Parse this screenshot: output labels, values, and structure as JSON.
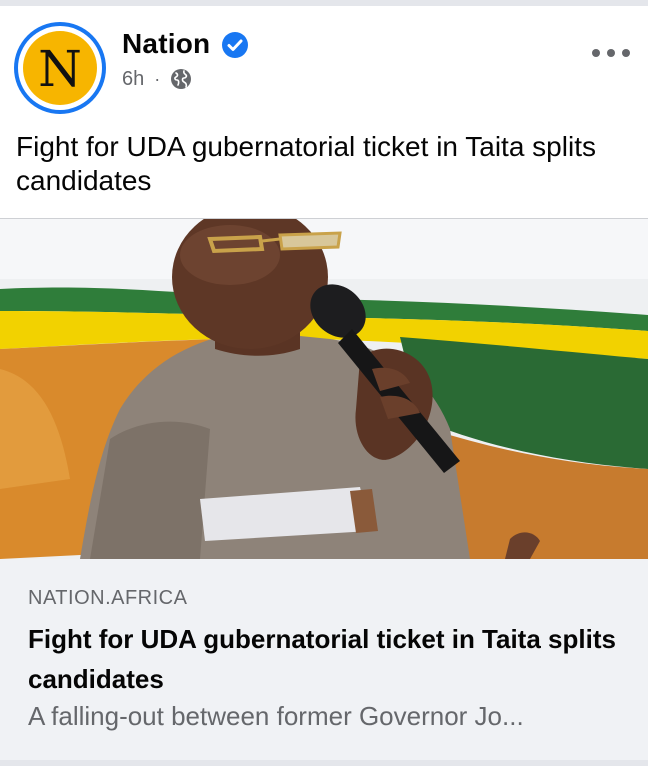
{
  "post": {
    "page_name": "Nation",
    "avatar_letter": "N",
    "time": "6h",
    "separator": "·",
    "audience_icon": "globe-icon",
    "verified_icon": "verified-badge-icon",
    "more_icon": "more-options-icon",
    "text": "Fight for UDA gubernatorial ticket in Taita splits candidates"
  },
  "link_preview": {
    "domain": "NATION.AFRICA",
    "title": "Fight for UDA gubernatorial ticket in Taita splits candidates",
    "description": "A falling-out between former Governor Jo..."
  },
  "colors": {
    "brand_blue": "#1877f2",
    "avatar_yellow": "#f7b500",
    "secondary_text": "#65676b",
    "preview_bg": "#f0f2f5"
  }
}
